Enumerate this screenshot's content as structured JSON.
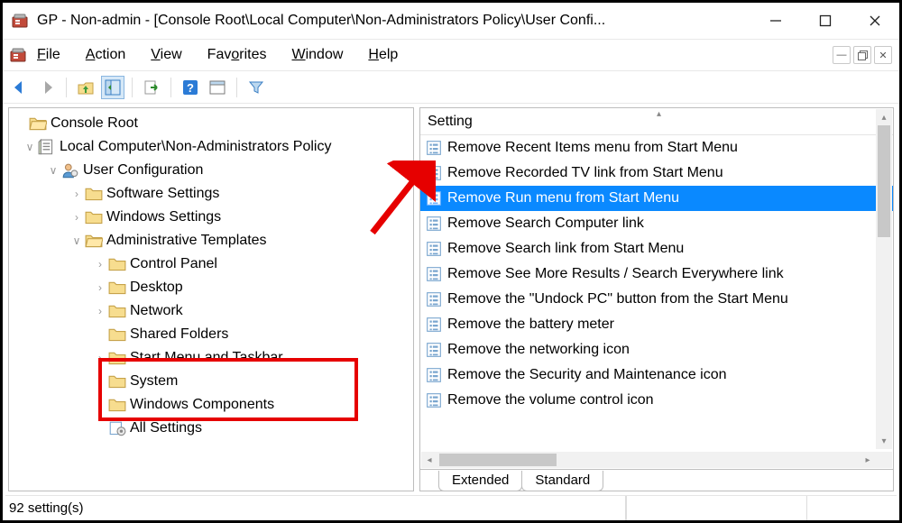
{
  "window": {
    "title": "GP - Non-admin - [Console Root\\Local Computer\\Non-Administrators Policy\\User Confi..."
  },
  "menu": {
    "file": "File",
    "action": "Action",
    "view": "View",
    "favorites": "Favorites",
    "window": "Window",
    "help": "Help"
  },
  "tree": {
    "root": "Console Root",
    "policy": "Local Computer\\Non-Administrators Policy",
    "userconfig": "User Configuration",
    "children": [
      "Software Settings",
      "Windows Settings",
      "Administrative Templates"
    ],
    "admin_children": [
      "Control Panel",
      "Desktop",
      "Network",
      "Shared Folders",
      "Start Menu and Taskbar",
      "System",
      "Windows Components",
      "All Settings"
    ]
  },
  "list": {
    "header": "Setting",
    "items": [
      "Remove Recent Items menu from Start Menu",
      "Remove Recorded TV link from Start Menu",
      "Remove Run menu from Start Menu",
      "Remove Search Computer link",
      "Remove Search link from Start Menu",
      "Remove See More Results / Search Everywhere link",
      "Remove the \"Undock PC\" button from the Start Menu",
      "Remove the battery meter",
      "Remove the networking icon",
      "Remove the Security and Maintenance icon",
      "Remove the volume control icon"
    ],
    "selected_index": 2
  },
  "tabs": {
    "extended": "Extended",
    "standard": "Standard"
  },
  "status": "92 setting(s)"
}
